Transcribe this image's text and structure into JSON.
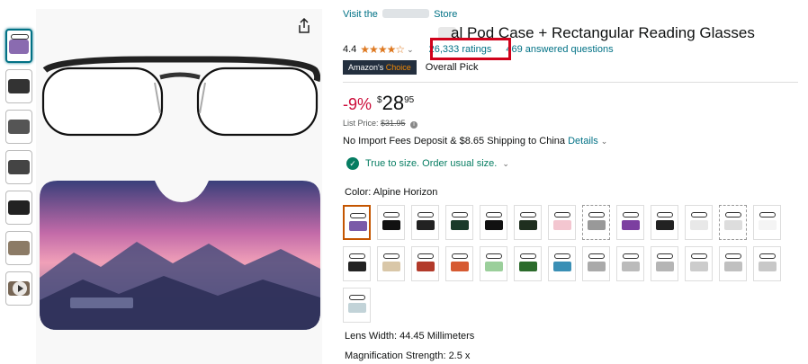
{
  "colors": {
    "link": "#007185",
    "price_discount": "#cc0c39",
    "stars": "#de7921",
    "highlight_box": "#d0021b",
    "fit_green": "#067d62",
    "badge_bg": "#232f3e"
  },
  "gallery": {
    "thumbnails": [
      {
        "type": "image",
        "selected": true,
        "accent": "#8a6bb0"
      },
      {
        "type": "image",
        "selected": false,
        "accent": "#333333"
      },
      {
        "type": "image",
        "selected": false,
        "accent": "#555555"
      },
      {
        "type": "image",
        "selected": false,
        "accent": "#444444"
      },
      {
        "type": "image",
        "selected": false,
        "accent": "#222222"
      },
      {
        "type": "image",
        "selected": false,
        "accent": "#8c7b66"
      },
      {
        "type": "video",
        "selected": false,
        "accent": "#776655"
      }
    ],
    "share_icon": "share-icon"
  },
  "store": {
    "prefix": "Visit the",
    "suffix": "Store"
  },
  "product": {
    "title_visible": "al Pod Case + Rectangular Reading Glasses",
    "rating_value": "4.4",
    "stars": "★★★★☆",
    "ratings_count": "26,333 ratings",
    "answered_questions": "469 answered questions",
    "badge_prefix": "Amazon's",
    "badge_choice": "Choice",
    "overall_pick": "Overall Pick"
  },
  "price": {
    "discount": "-9%",
    "currency": "$",
    "whole": "28",
    "fraction": "95",
    "list_label": "List Price:",
    "list_value": "$31.95"
  },
  "shipping": {
    "text": "No Import Fees Deposit & $8.65 Shipping to China",
    "details": "Details"
  },
  "fit": {
    "text": "True to size. Order usual size."
  },
  "color": {
    "label": "Color: Alpine Horizon",
    "swatches": [
      {
        "case": "#7a5aa8",
        "selected": true,
        "dashed": false
      },
      {
        "case": "#111111",
        "selected": false,
        "dashed": false
      },
      {
        "case": "#222222",
        "selected": false,
        "dashed": false
      },
      {
        "case": "#1a3a2a",
        "selected": false,
        "dashed": false
      },
      {
        "case": "#111111",
        "selected": false,
        "dashed": false
      },
      {
        "case": "#1f2f1f",
        "selected": false,
        "dashed": false
      },
      {
        "case": "#f3c6d0",
        "selected": false,
        "dashed": false
      },
      {
        "case": "#999999",
        "selected": false,
        "dashed": true
      },
      {
        "case": "#7c3fa0",
        "selected": false,
        "dashed": false
      },
      {
        "case": "#222222",
        "selected": false,
        "dashed": false
      },
      {
        "case": "#e8e8e8",
        "selected": false,
        "dashed": false
      },
      {
        "case": "#dddddd",
        "selected": false,
        "dashed": true
      },
      {
        "case": "#f4f4f4",
        "selected": false,
        "dashed": false
      },
      {
        "case": "#222222",
        "selected": false,
        "dashed": false
      },
      {
        "case": "#d9c7a8",
        "selected": false,
        "dashed": false
      },
      {
        "case": "#b23a2a",
        "selected": false,
        "dashed": false
      },
      {
        "case": "#d65a32",
        "selected": false,
        "dashed": false
      },
      {
        "case": "#9bcf9b",
        "selected": false,
        "dashed": false
      },
      {
        "case": "#2b6b2b",
        "selected": false,
        "dashed": false
      },
      {
        "case": "#3a8fb5",
        "selected": false,
        "dashed": false
      },
      {
        "case": "#aaaaaa",
        "selected": false,
        "dashed": false
      },
      {
        "case": "#bbbbbb",
        "selected": false,
        "dashed": false
      },
      {
        "case": "#b5b5b5",
        "selected": false,
        "dashed": false
      },
      {
        "case": "#cccccc",
        "selected": false,
        "dashed": false
      },
      {
        "case": "#c0c0c0",
        "selected": false,
        "dashed": false
      },
      {
        "case": "#c8c8c8",
        "selected": false,
        "dashed": false
      },
      {
        "case": "#c2d3d8",
        "selected": false,
        "dashed": false
      }
    ]
  },
  "specs": [
    {
      "text": "Lens Width: 44.45 Millimeters"
    },
    {
      "text": "Magnification Strength: 2.5 x"
    }
  ]
}
